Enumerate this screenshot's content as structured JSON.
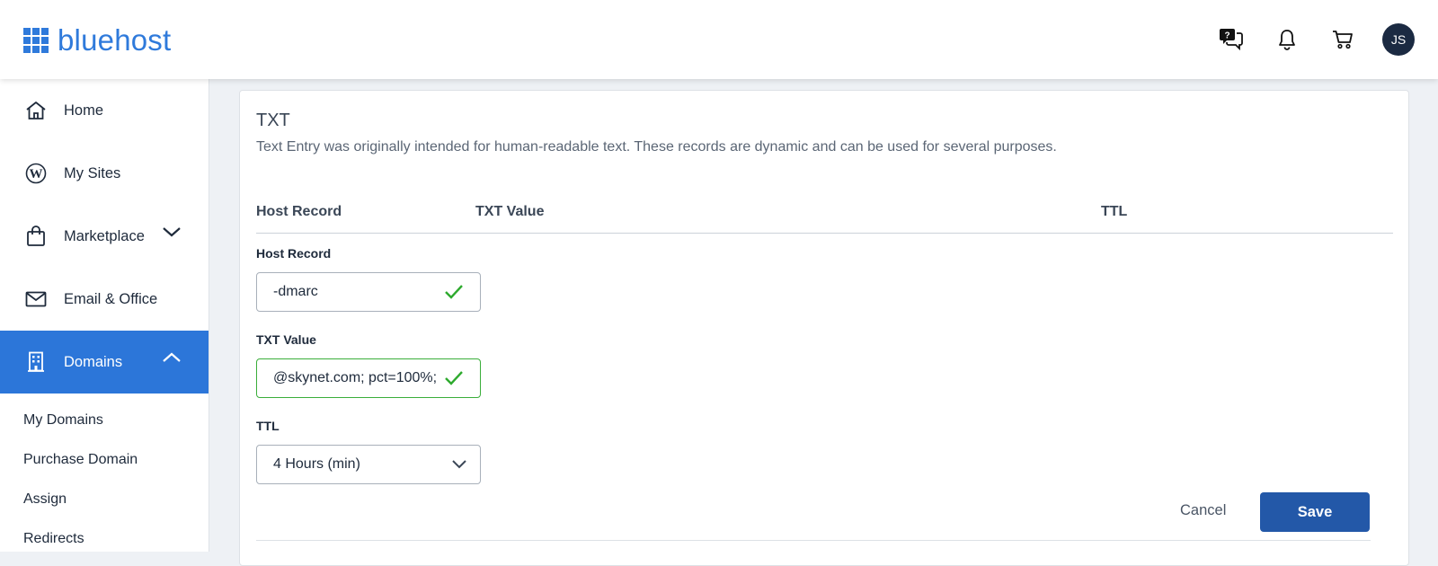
{
  "header": {
    "logo_text": "bluehost",
    "icons": [
      "help-chat-icon",
      "bell-icon",
      "cart-icon"
    ],
    "avatar_initials": "JS"
  },
  "sidebar": {
    "items": [
      {
        "label": "Home",
        "icon": "home-icon"
      },
      {
        "label": "My Sites",
        "icon": "wordpress-icon"
      },
      {
        "label": "Marketplace",
        "icon": "shopping-bag-icon",
        "chevron": "down"
      },
      {
        "label": "Email & Office",
        "icon": "mail-icon"
      },
      {
        "label": "Domains",
        "icon": "building-icon",
        "chevron": "up",
        "active": true
      }
    ],
    "sub_items": [
      "My Domains",
      "Purchase Domain",
      "Assign",
      "Redirects"
    ]
  },
  "card": {
    "title": "TXT",
    "description": "Text Entry was originally intended for human-readable text. These records are dynamic and can be used for several purposes.",
    "columns": [
      "Host Record",
      "TXT Value",
      "TTL"
    ],
    "form": {
      "host_record": {
        "label": "Host Record",
        "value": "-dmarc",
        "valid": true
      },
      "txt_value": {
        "label": "TXT Value",
        "value": "@skynet.com; pct=100%;",
        "valid": true
      },
      "ttl": {
        "label": "TTL",
        "selected": "4 Hours (min)"
      }
    },
    "cancel_label": "Cancel",
    "save_label": "Save"
  },
  "colors": {
    "brand": "#2f7adb",
    "active_nav": "#2c76d9",
    "save_button": "#2358a8",
    "valid_green": "#3aae3a"
  }
}
